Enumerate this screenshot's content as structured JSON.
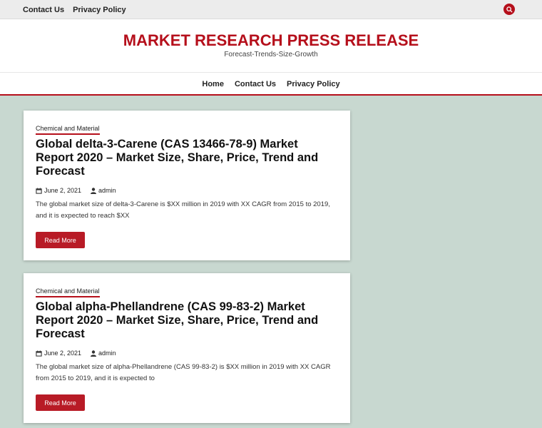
{
  "topbar": {
    "links": [
      "Contact Us",
      "Privacy Policy"
    ],
    "search_icon": "search-icon"
  },
  "site": {
    "title": "MARKET RESEARCH PRESS RELEASE",
    "tagline": "Forecast-Trends-Size-Growth"
  },
  "nav": {
    "items": [
      "Home",
      "Contact Us",
      "Privacy Policy"
    ]
  },
  "posts": [
    {
      "category": "Chemical and Material",
      "title": "Global delta-3-Carene (CAS 13466-78-9) Market Report 2020 – Market Size, Share, Price, Trend and Forecast",
      "date": "June 2, 2021",
      "author": "admin",
      "excerpt": "The global market size of delta-3-Carene is $XX million in 2019 with XX CAGR from 2015 to 2019, and it is expected to reach $XX",
      "read_more": "Read More"
    },
    {
      "category": "Chemical and Material",
      "title": "Global alpha-Phellandrene (CAS 99-83-2) Market Report 2020 – Market Size, Share, Price, Trend and Forecast",
      "date": "June 2, 2021",
      "author": "admin",
      "excerpt": "The global market size of alpha-Phellandrene (CAS 99-83-2) is $XX million in 2019 with XX CAGR from 2015 to 2019, and it is expected to",
      "read_more": "Read More"
    }
  ],
  "colors": {
    "accent": "#b50f1b",
    "background": "#c8d8d0"
  }
}
